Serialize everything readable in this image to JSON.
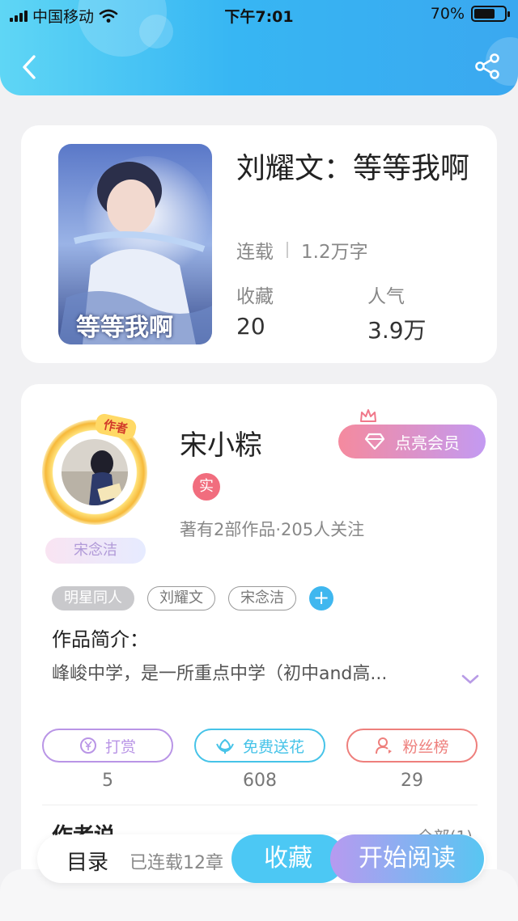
{
  "status_bar": {
    "carrier": "中国移动",
    "time": "下午7:01",
    "battery": "70%",
    "battery_level": 0.7
  },
  "nav": {
    "back_icon": "chevron-left-icon",
    "share_icon": "share-icon"
  },
  "book": {
    "title": "刘耀文：等等我啊",
    "status": "连载",
    "word_count": "1.2万字",
    "stats": [
      {
        "label": "收藏",
        "value": "20"
      },
      {
        "label": "人气",
        "value": "3.9万"
      }
    ],
    "cover_text": "等等我啊"
  },
  "author": {
    "badge": "作者",
    "name": "宋小粽",
    "tag": "宋念洁",
    "verified": "实",
    "info": "著有2部作品·205人关注",
    "vip_button": "点亮会员"
  },
  "tags": [
    "明星同人",
    "刘耀文",
    "宋念洁"
  ],
  "intro": {
    "title": "作品简介：",
    "text": "峰峻中学，是一所重点中学（初中and高..."
  },
  "actions": [
    {
      "label": "打赏",
      "count": "5",
      "color": "#b995e6",
      "icon": "yen-coin-icon"
    },
    {
      "label": "免费送花",
      "count": "608",
      "color": "#46c3e8",
      "icon": "flower-icon"
    },
    {
      "label": "粉丝榜",
      "count": "29",
      "color": "#ee7f7c",
      "icon": "fan-user-icon"
    }
  ],
  "author_say": {
    "title": "作者说",
    "all_link": "全部(1)"
  },
  "bottom_bar": {
    "toc": "目录",
    "chapters": "已连载12章",
    "collect": "收藏",
    "read": "开始阅读"
  },
  "colors": {
    "header_gradient": [
      "#5fd6f5",
      "#3aa8f0"
    ],
    "accent_blue": "#4cc8f4",
    "vip_gradient": [
      "#f58a9e",
      "#c39af2"
    ]
  }
}
